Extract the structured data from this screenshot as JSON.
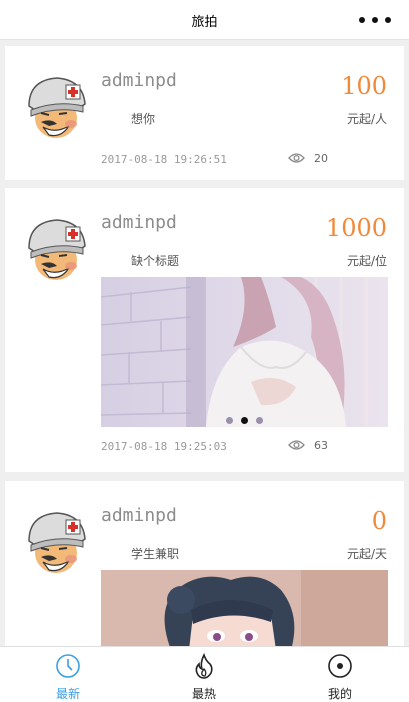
{
  "navbar": {
    "title": "旅拍",
    "more_icon": "more-dots-icon"
  },
  "posts": [
    {
      "username": "adminpd",
      "price": "100",
      "title": "想你",
      "unit": "元起/人",
      "time": "2017-08-18 19:26:51",
      "views": "20"
    },
    {
      "username": "adminpd",
      "price": "1000",
      "title": "缺个标题",
      "unit": "元起/位",
      "time": "2017-08-18 19:25:03",
      "views": "63",
      "carousel": {
        "slides": 3,
        "active_index": 1
      }
    },
    {
      "username": "adminpd",
      "price": "0",
      "title": "学生兼职",
      "unit": "元起/天"
    }
  ],
  "tabbar": {
    "tabs": [
      {
        "label": "最新",
        "icon": "clock-icon"
      },
      {
        "label": "最热",
        "icon": "flame-icon"
      },
      {
        "label": "我的",
        "icon": "target-icon"
      }
    ],
    "active_color": "#3a9ee4",
    "inactive_color": "#222222"
  },
  "colors": {
    "price": "#f1893a",
    "username": "#8c8c8c",
    "background": "#efefef"
  }
}
